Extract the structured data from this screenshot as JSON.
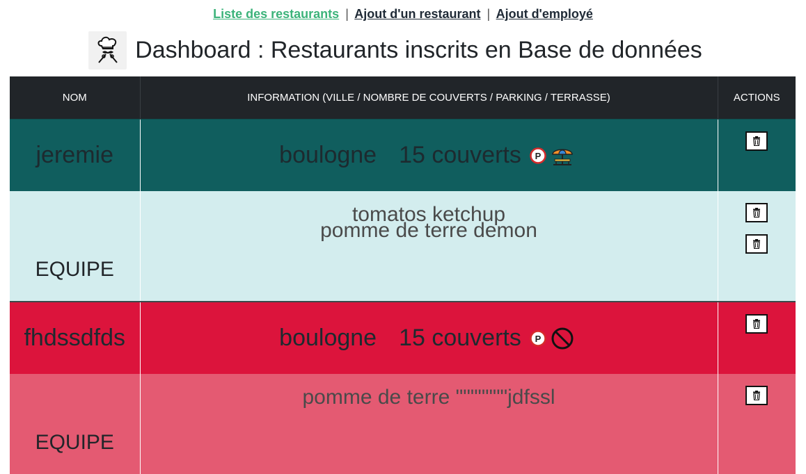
{
  "nav": {
    "links": [
      "Liste des restaurants",
      "Ajout d'un restaurant",
      "Ajout d'employé"
    ],
    "separator": "|"
  },
  "page": {
    "title": "Dashboard : Restaurants inscrits en Base de données",
    "logo_icon": "chef-logo-icon"
  },
  "table": {
    "headers": [
      "NOM",
      "INFORMATION (VILLE / NOMBRE DE COUVERTS / PARKING / TERRASSE)",
      "ACTIONS"
    ]
  },
  "restaurants": [
    {
      "nom": "jeremie",
      "ville": "boulogne",
      "couverts": "15 couverts",
      "parking_icon": "parking-icon",
      "terrasse_icon": "terrace-umbrella-icon",
      "row_color": "#105e5e",
      "team_label": "EQUIPE",
      "team_members": [
        "tomatos ketchup",
        "pomme de terre demon"
      ],
      "team_color": "#d3edee"
    },
    {
      "nom": "fhdssdfds",
      "ville": "boulogne",
      "couverts": "15 couverts",
      "parking_icon": "parking-icon",
      "terrasse_icon": "no-terrace-icon",
      "row_color": "#dc143c",
      "team_label": "EQUIPE",
      "team_members": [
        "pomme de terre \"\"\"\"\"\"\"jdfssl"
      ],
      "team_color": "#e45a72"
    }
  ],
  "actions": {
    "delete_icon": "trash-icon"
  }
}
